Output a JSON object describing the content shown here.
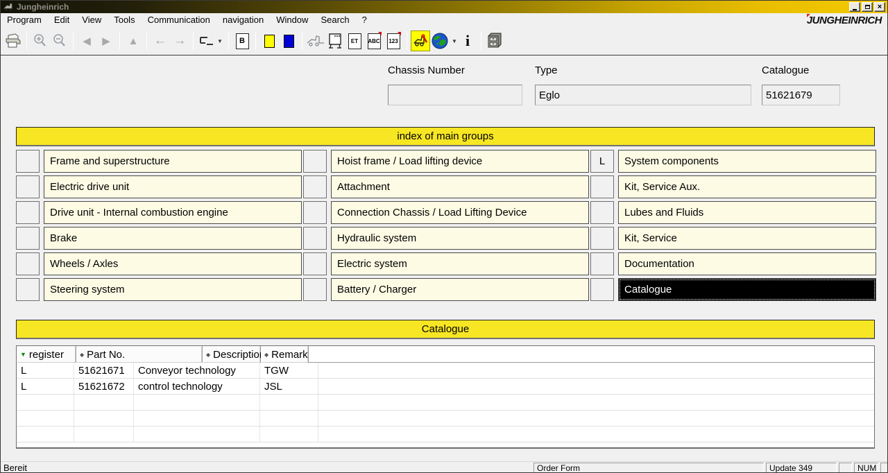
{
  "window": {
    "title": "Jungheinrich"
  },
  "brand": {
    "logo_j": "J",
    "logo_rest": "UNGHEINRICH"
  },
  "menu": {
    "items": [
      "Program",
      "Edit",
      "View",
      "Tools",
      "Communication",
      "navigation",
      "Window",
      "Search",
      "?"
    ]
  },
  "icons": {
    "close": "×",
    "back": "◀",
    "forward": "▶",
    "up": "▲",
    "prev": "←",
    "next": "→",
    "caret": "▼",
    "b_doc": "B",
    "et_doc": "ET",
    "abc_doc": "ABC",
    "num_doc": "123",
    "info": "i"
  },
  "form": {
    "fields": [
      {
        "label": "Chassis Number",
        "value": ""
      },
      {
        "label": "Type",
        "value": "Eglo"
      },
      {
        "label": "Catalogue",
        "value": "51621679"
      }
    ]
  },
  "main_groups": {
    "title": "index of main groups",
    "columns": [
      [
        {
          "register": "",
          "label": "Frame and superstructure"
        },
        {
          "register": "",
          "label": "Electric drive unit"
        },
        {
          "register": "",
          "label": "Drive unit - Internal combustion engine"
        },
        {
          "register": "",
          "label": "Brake"
        },
        {
          "register": "",
          "label": "Wheels / Axles"
        },
        {
          "register": "",
          "label": "Steering system"
        }
      ],
      [
        {
          "register": "",
          "label": "Hoist frame / Load lifting device"
        },
        {
          "register": "",
          "label": "Attachment"
        },
        {
          "register": "",
          "label": "Connection Chassis / Load Lifting Device"
        },
        {
          "register": "",
          "label": "Hydraulic system"
        },
        {
          "register": "",
          "label": "Electric system"
        },
        {
          "register": "",
          "label": "Battery / Charger"
        }
      ],
      [
        {
          "register": "L",
          "label": "System components"
        },
        {
          "register": "",
          "label": "Kit, Service Aux."
        },
        {
          "register": "",
          "label": "Lubes and Fluids"
        },
        {
          "register": "",
          "label": "Kit, Service"
        },
        {
          "register": "",
          "label": "Documentation"
        },
        {
          "register": "",
          "label": "Catalogue",
          "selected": true
        }
      ]
    ]
  },
  "catalogue": {
    "title": "Catalogue",
    "columns": [
      {
        "label": "register",
        "marker": "▼",
        "sorted": true
      },
      {
        "label": "Part No.",
        "marker": "◆",
        "sorted": false
      },
      {
        "label": "Description",
        "marker": "◆",
        "sorted": false
      },
      {
        "label": "Remark",
        "marker": "◆",
        "sorted": false
      }
    ],
    "rows": [
      [
        "L",
        "51621671",
        "Conveyor technology",
        "TGW"
      ],
      [
        "L",
        "51621672",
        "control technology",
        "JSL"
      ]
    ]
  },
  "status": {
    "left": "Bereit",
    "panels": [
      "Order Form",
      "Update 349",
      "",
      "NUM",
      ""
    ]
  },
  "colors": {
    "accent_yellow": "#f7e623",
    "cell_ivory": "#fdfbe4",
    "pure_yellow": "#ffff00",
    "pure_blue": "#0000d8",
    "title_dark": "#131307",
    "title_gold": "#f3ca00",
    "selected_bg": "#000000"
  }
}
